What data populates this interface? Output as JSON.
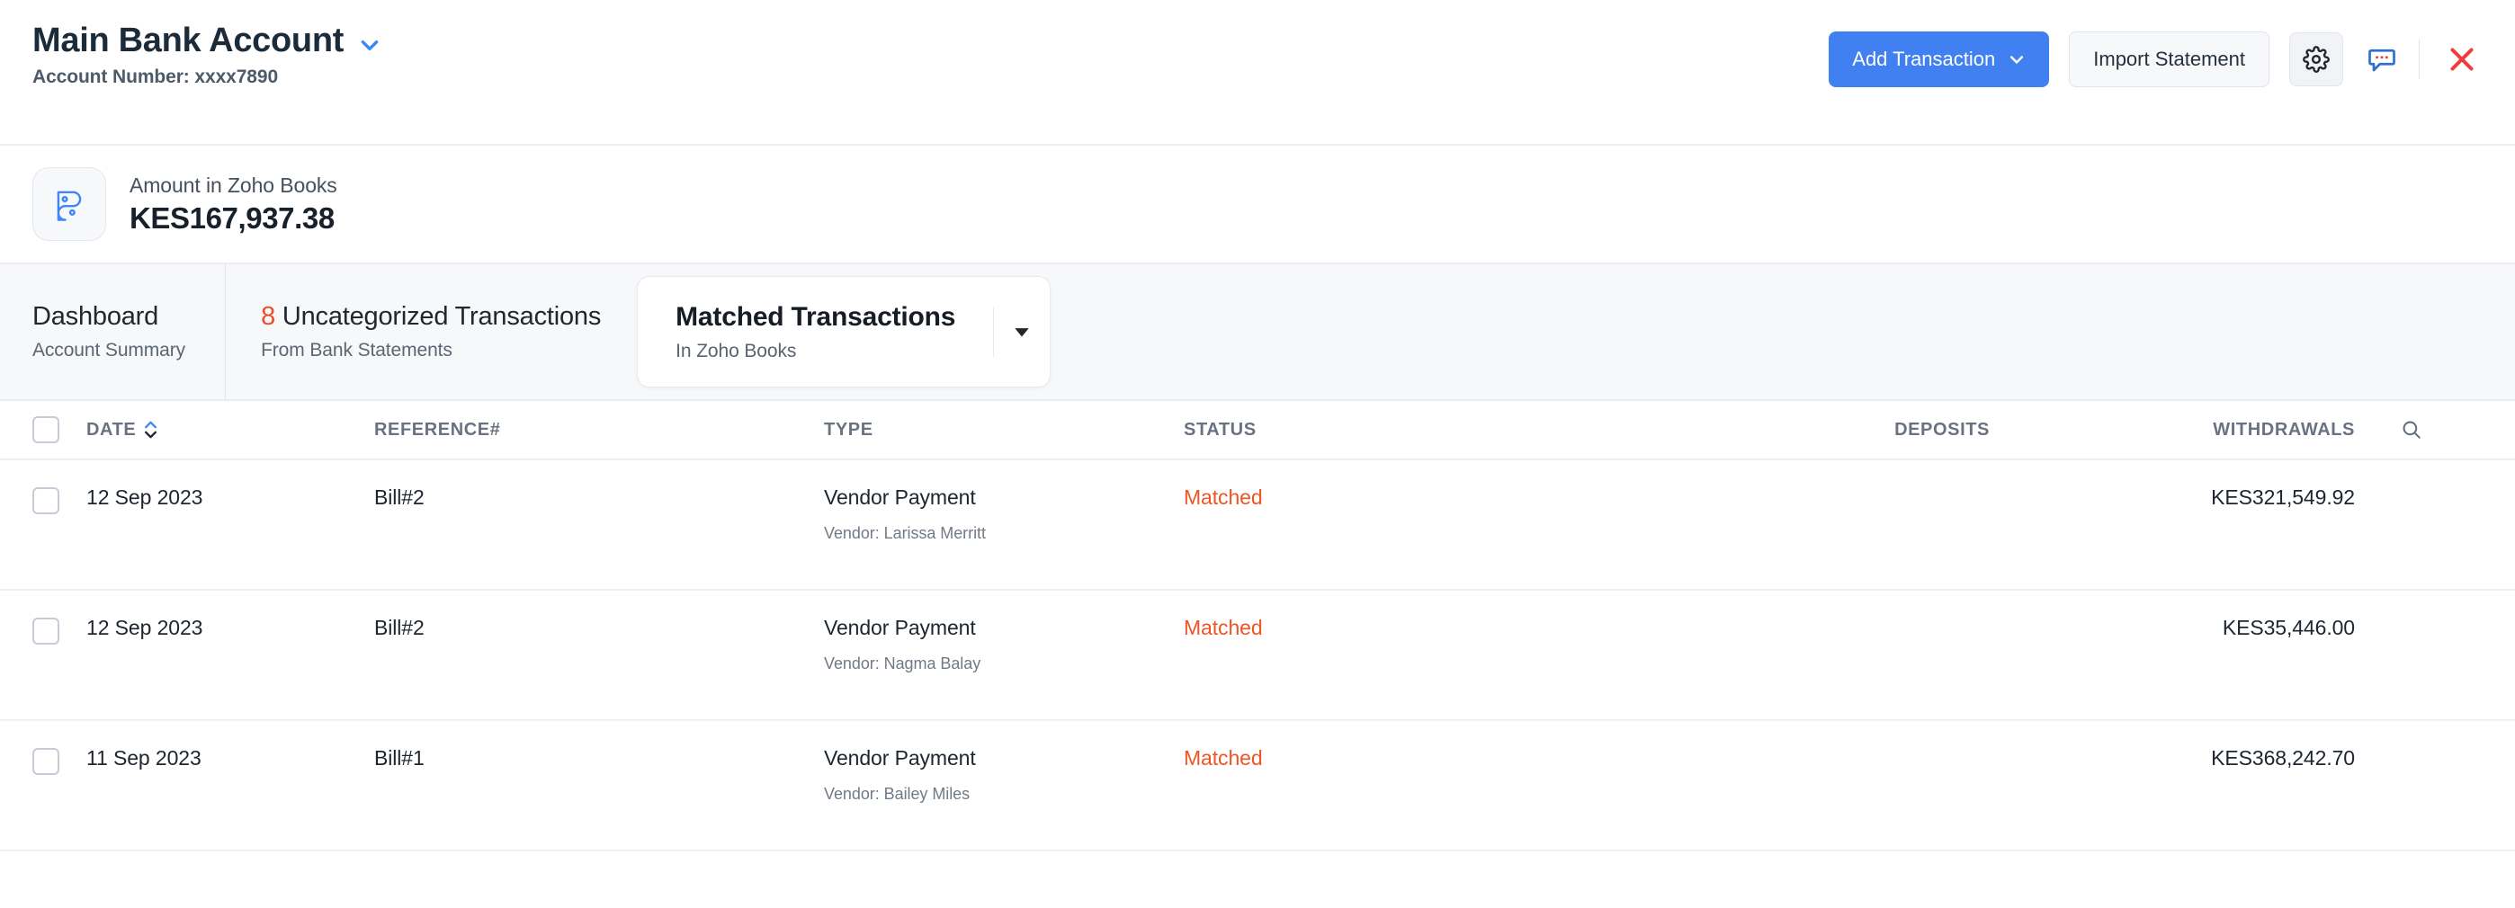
{
  "header": {
    "account_title": "Main Bank Account",
    "account_dropdown_icon": "chevron-down-icon",
    "account_number": "Account Number: xxxx7890",
    "add_transaction_label": "Add Transaction",
    "add_transaction_caret_icon": "chevron-down-icon",
    "import_statement_label": "Import Statement",
    "settings_icon": "gear-icon",
    "comment_icon": "comment-bubble-icon",
    "close_icon": "close-x-icon",
    "primary_color": "#4080f0",
    "close_color": "#ee3d3d"
  },
  "amount_bar": {
    "brand_icon": "zoho-books-icon",
    "label": "Amount in Zoho Books",
    "value": "KES167,937.38"
  },
  "tabs": [
    {
      "title": "Dashboard",
      "subtitle": "Account Summary",
      "count": "",
      "active": false
    },
    {
      "title": "Uncategorized Transactions",
      "subtitle": "From Bank Statements",
      "count": "8",
      "active": false
    },
    {
      "title": "Matched Transactions",
      "subtitle": "In Zoho Books",
      "count": "",
      "active": true,
      "caret_icon": "caret-down-icon"
    }
  ],
  "table": {
    "select_all_name": "select-all-checkbox",
    "columns": {
      "date": "DATE",
      "reference": "REFERENCE#",
      "type": "TYPE",
      "status": "STATUS",
      "deposits": "DEPOSITS",
      "withdrawals": "WITHDRAWALS"
    },
    "sort": {
      "column": "DATE",
      "direction": "asc",
      "icon": "sort-chevrons-icon",
      "active_color": "#3e87f5"
    },
    "search_icon": "search-icon",
    "rows": [
      {
        "date": "12 Sep 2023",
        "reference": "Bill#2",
        "type": "Vendor Payment",
        "type_sub": "Vendor: Larissa Merritt",
        "status": "Matched",
        "deposits": "",
        "withdrawals": "KES321,549.92"
      },
      {
        "date": "12 Sep 2023",
        "reference": "Bill#2",
        "type": "Vendor Payment",
        "type_sub": "Vendor: Nagma Balay",
        "status": "Matched",
        "deposits": "",
        "withdrawals": "KES35,446.00"
      },
      {
        "date": "11 Sep 2023",
        "reference": "Bill#1",
        "type": "Vendor Payment",
        "type_sub": "Vendor: Bailey Miles",
        "status": "Matched",
        "deposits": "",
        "withdrawals": "KES368,242.70"
      }
    ]
  }
}
